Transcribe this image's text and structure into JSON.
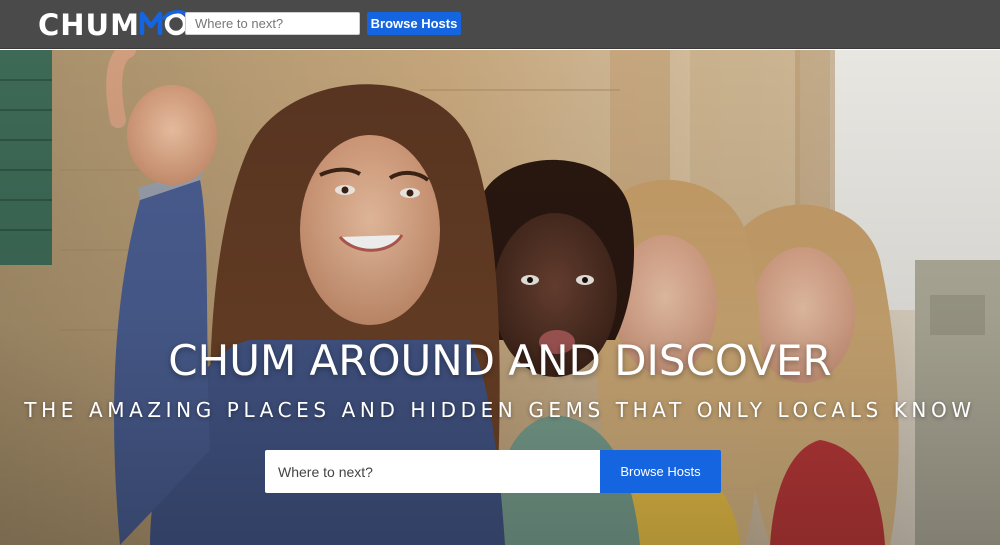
{
  "navbar": {
    "logo": {
      "text": "CHUM",
      "mark_icon": "mo-swirl-logo-icon",
      "accent": "#1565e0"
    },
    "search": {
      "placeholder": "Where to next?"
    },
    "browse_label": "Browse Hosts",
    "background": "#4a4a4a"
  },
  "hero": {
    "image_alt": "",
    "title": "CHUM AROUND AND DISCOVER",
    "subtitle": "THE AMAZING PLACES AND HIDDEN GEMS THAT ONLY LOCALS KNOW",
    "search": {
      "placeholder": "Where to next?"
    },
    "browse_label": "Browse Hosts"
  },
  "colors": {
    "primary": "#1565e0",
    "navbar": "#4a4a4a",
    "text_light": "#ffffff"
  }
}
